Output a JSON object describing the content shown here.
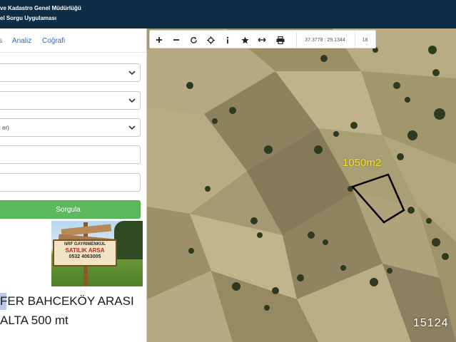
{
  "header": {
    "title_line1": "ve Kadastro Genel Müdürlüğü",
    "title_line2": "el Sorgu Uygulaması"
  },
  "tabs": [
    {
      "label": "s"
    },
    {
      "label": "Analiz"
    },
    {
      "label": "Coğrafi"
    }
  ],
  "form": {
    "fields": [
      {
        "value": ""
      },
      {
        "value": ""
      },
      {
        "value": "er)"
      },
      {
        "value": ""
      },
      {
        "value": ""
      }
    ],
    "submit_label": "Sorgula"
  },
  "ad": {
    "line1": "NRF GAYRIMENKUL",
    "line2": "SATILIK ARSA",
    "line3": "0532 4063005"
  },
  "caption": {
    "line1": "FER BAHCEKÖY ARASI",
    "line2": "ALTA  500 mt"
  },
  "map": {
    "coordinates": "37.3778 : 29.1344",
    "zoom": "18",
    "area_label": "1050m2",
    "watermark": "15124",
    "parcel_color": "#000000",
    "label_color": "#f6e51a"
  },
  "toolbar": {
    "icons": [
      "plus-icon",
      "minus-icon",
      "refresh-icon",
      "target-icon",
      "info-icon",
      "star-icon",
      "measure-icon",
      "print-icon"
    ]
  },
  "colors": {
    "header_bg": "#0f2d45",
    "accent_blue": "#2a6bb5",
    "submit_green": "#5cb85c"
  }
}
